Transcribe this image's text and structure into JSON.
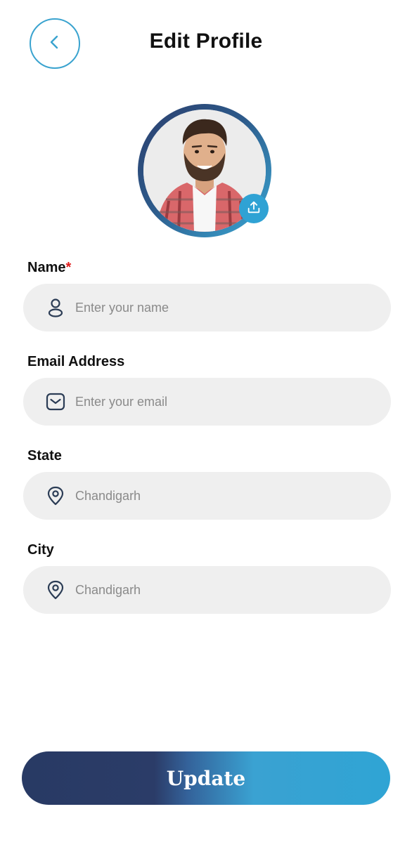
{
  "header": {
    "title": "Edit Profile"
  },
  "form": {
    "name": {
      "label": "Name",
      "required_mark": "*",
      "placeholder": "Enter your name",
      "value": ""
    },
    "email": {
      "label": "Email Address",
      "placeholder": "Enter your email",
      "value": ""
    },
    "state": {
      "label": "State",
      "placeholder": "Chandigarh",
      "value": ""
    },
    "city": {
      "label": "City",
      "placeholder": "Chandigarh",
      "value": ""
    }
  },
  "actions": {
    "update_label": "Update"
  },
  "icons": {
    "back": "chevron-left-icon",
    "upload": "upload-icon",
    "name": "user-icon",
    "email": "mail-icon",
    "state": "location-pin-icon",
    "city": "location-pin-icon"
  },
  "colors": {
    "accent": "#3aa3cf",
    "button_gradient_start": "#283a64",
    "button_gradient_end": "#2fa4d4",
    "field_background": "#efefef",
    "required": "#e01b1b"
  }
}
